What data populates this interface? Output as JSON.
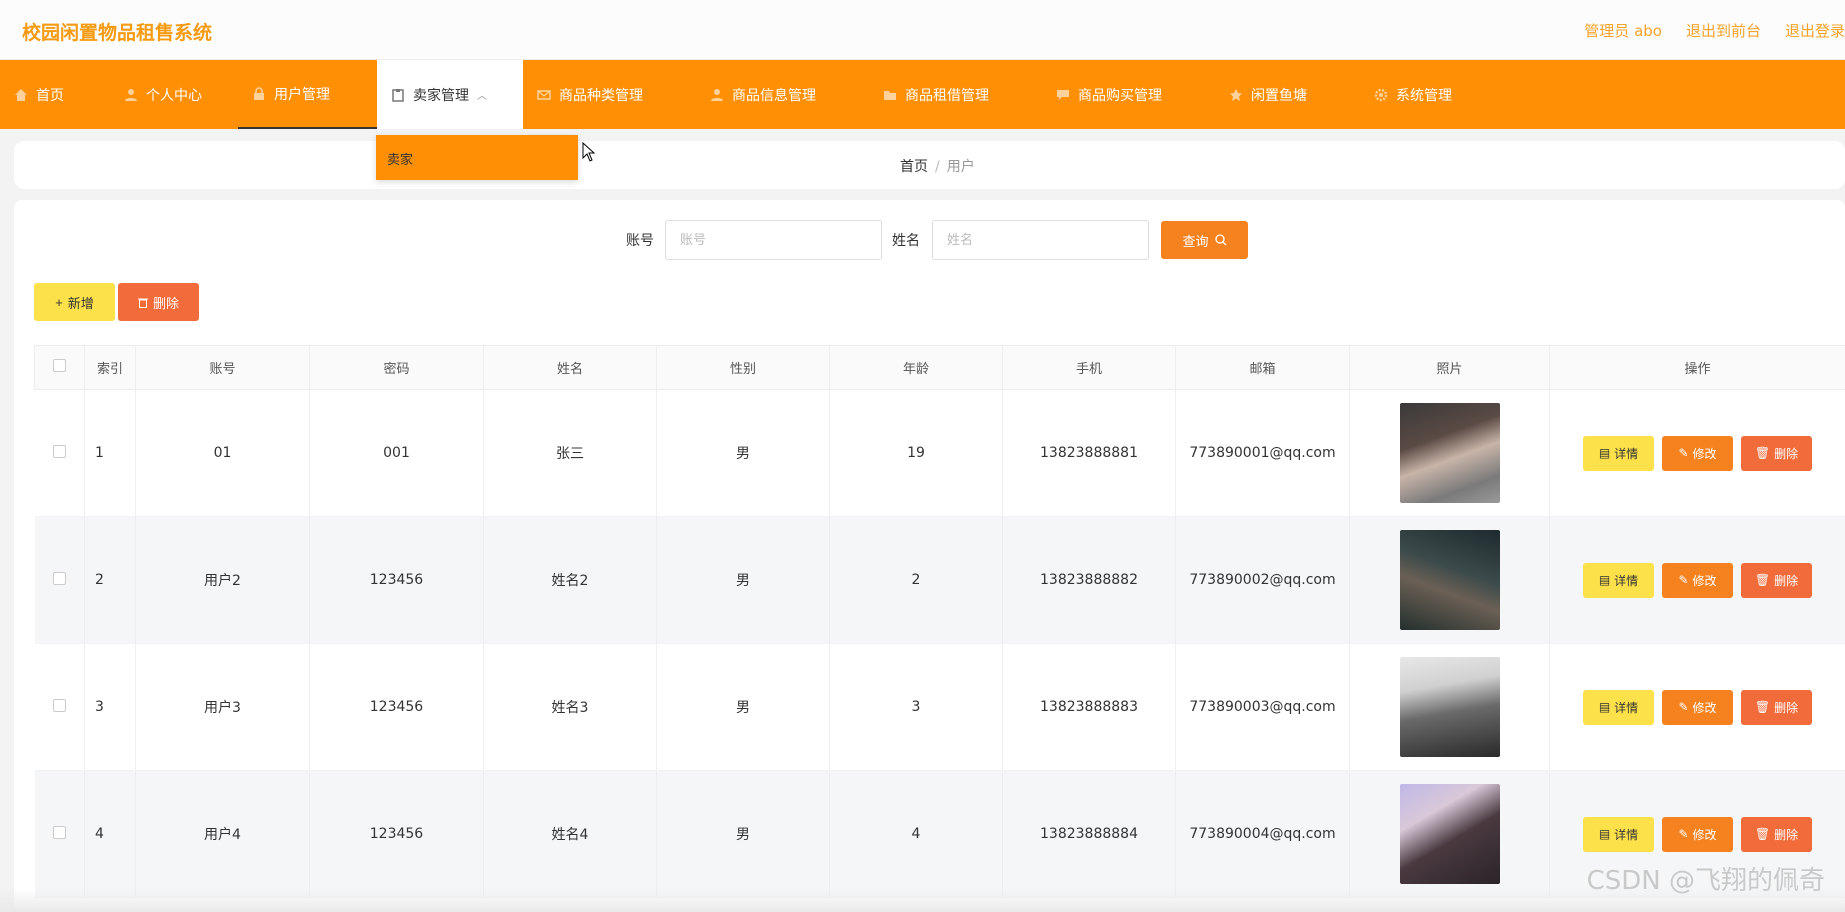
{
  "app": {
    "title": "校园闲置物品租售系统"
  },
  "top_actions": {
    "admin": "管理员 abo",
    "to_front": "退出到前台",
    "logout": "退出登录"
  },
  "nav": {
    "items": [
      {
        "label": "首页"
      },
      {
        "label": "个人中心"
      },
      {
        "label": "用户管理"
      },
      {
        "label": "卖家管理"
      },
      {
        "label": "商品种类管理"
      },
      {
        "label": "商品信息管理"
      },
      {
        "label": "商品租借管理"
      },
      {
        "label": "商品购买管理"
      },
      {
        "label": "闲置鱼塘"
      },
      {
        "label": "系统管理"
      }
    ],
    "dropdown_item": "卖家"
  },
  "breadcrumb": {
    "home": "首页",
    "sep": "/",
    "current": "用户"
  },
  "search": {
    "account_label": "账号",
    "account_placeholder": "账号",
    "name_label": "姓名",
    "name_placeholder": "姓名",
    "query_button": "查询"
  },
  "toolbar": {
    "add_button": "新增",
    "delete_button": "删除"
  },
  "table": {
    "headers": [
      "索引",
      "账号",
      "密码",
      "姓名",
      "性别",
      "年龄",
      "手机",
      "邮箱",
      "照片",
      "操作"
    ],
    "rows": [
      {
        "index": "1",
        "account": "01",
        "password": "001",
        "name": "张三",
        "gender": "男",
        "age": "19",
        "phone": "13823888881",
        "email": "773890001@qq.com"
      },
      {
        "index": "2",
        "account": "用户2",
        "password": "123456",
        "name": "姓名2",
        "gender": "男",
        "age": "2",
        "phone": "13823888882",
        "email": "773890002@qq.com"
      },
      {
        "index": "3",
        "account": "用户3",
        "password": "123456",
        "name": "姓名3",
        "gender": "男",
        "age": "3",
        "phone": "13823888883",
        "email": "773890003@qq.com"
      },
      {
        "index": "4",
        "account": "用户4",
        "password": "123456",
        "name": "姓名4",
        "gender": "男",
        "age": "4",
        "phone": "13823888884",
        "email": "773890004@qq.com"
      }
    ],
    "row_actions": {
      "detail": "详情",
      "edit": "修改",
      "delete": "删除"
    }
  },
  "watermark": "CSDN @飞翔的佩奇",
  "colors": {
    "brand": "#ff9006",
    "yellow": "#fde14a",
    "orange": "#f5821f",
    "red": "#f26b3a"
  }
}
